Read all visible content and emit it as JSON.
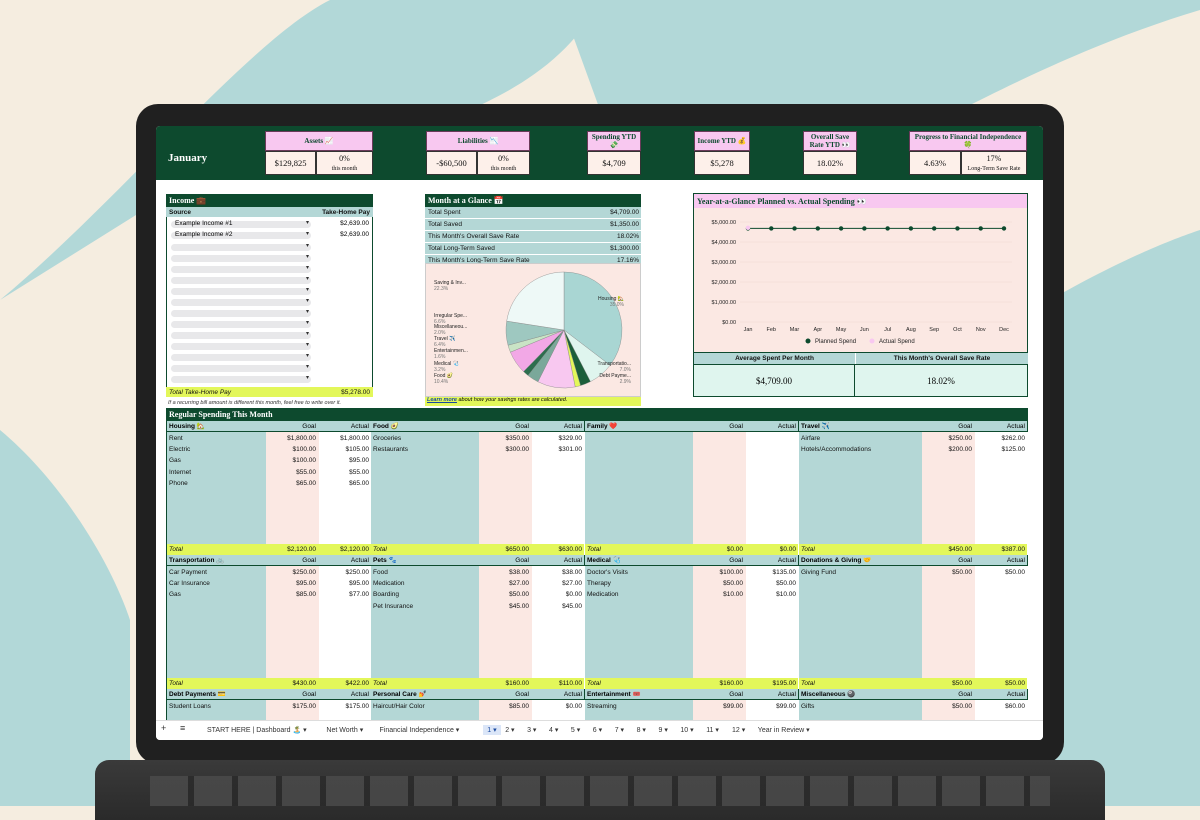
{
  "month": "January",
  "kpis": {
    "assets": {
      "label": "Assets 📈",
      "value": "$129,825",
      "pct": "0%",
      "sub": "this month"
    },
    "liabilities": {
      "label": "Liabilities 📉",
      "value": "-$60,500",
      "pct": "0%",
      "sub": "this month"
    },
    "spending": {
      "label": "Spending YTD💸",
      "value": "$4,709"
    },
    "income": {
      "label": "Income YTD 💰",
      "value": "$5,278"
    },
    "saverate": {
      "label": "Overall Save Rate YTD 👀",
      "value": "18.02%"
    },
    "progress": {
      "label": "Progress to Financial Independence 🍀",
      "value": "4.63%",
      "pct": "17%",
      "sub": "Long-Term Save Rate"
    }
  },
  "income": {
    "title": "Income 💼",
    "col_source": "Source",
    "col_pay": "Take-Home Pay",
    "rows": [
      {
        "name": "Example Income #1",
        "amount": "$2,639.00"
      },
      {
        "name": "Example Income #2",
        "amount": "$2,639.00"
      }
    ],
    "total_label": "Total Take-Home Pay",
    "total": "$5,278.00",
    "note": "If a recurring bill amount is different this month, feel free to write over it."
  },
  "glance": {
    "title": "Month at a Glance 📅",
    "rows": [
      {
        "label": "Total Spent",
        "value": "$4,709.00"
      },
      {
        "label": "Total Saved",
        "value": "$1,350.00"
      },
      {
        "label": "This Month's Overall Save Rate",
        "value": "18.02%"
      },
      {
        "label": "Total Long-Term Saved",
        "value": "$1,300.00"
      },
      {
        "label": "This Month's Long-Term Save Rate",
        "value": "17.16%"
      }
    ],
    "learn_link": "Learn more",
    "learn_text": " about how your savings rates are calculated."
  },
  "pie": {
    "labels": [
      {
        "name": "Saving & Inv...",
        "pct": "22.3%"
      },
      {
        "name": "Housing 🏡",
        "pct": "35.0%"
      },
      {
        "name": "Irregular Spe...",
        "pct": "6.6%"
      },
      {
        "name": "Miscellaneou...",
        "pct": "2.0%"
      },
      {
        "name": "Travel ✈️",
        "pct": "6.4%"
      },
      {
        "name": "Entertainmen...",
        "pct": "1.6%"
      },
      {
        "name": "Medical 🩺",
        "pct": "3.2%"
      },
      {
        "name": "Food 🥑",
        "pct": "10.4%"
      },
      {
        "name": "Transportatio...",
        "pct": "7.0%"
      },
      {
        "name": "Debt Payme...",
        "pct": "2.9%"
      }
    ],
    "slices": [
      {
        "v": 35.0,
        "c": "#a9d6d3"
      },
      {
        "v": 7.0,
        "c": "#dff5ee"
      },
      {
        "v": 2.9,
        "c": "#1b5e3a"
      },
      {
        "v": 1.5,
        "c": "#e3f75a"
      },
      {
        "v": 10.4,
        "c": "#f8c8f0"
      },
      {
        "v": 3.2,
        "c": "#7aa89a"
      },
      {
        "v": 1.6,
        "c": "#2d6e4e"
      },
      {
        "v": 6.4,
        "c": "#f2a8e6"
      },
      {
        "v": 2.0,
        "c": "#c9e4c5"
      },
      {
        "v": 6.6,
        "c": "#9ec8c0"
      },
      {
        "v": 22.3,
        "c": "#eef9f7"
      }
    ]
  },
  "chart_data": {
    "type": "line",
    "title": "Year-at-a-Glance Planned vs. Actual Spending 👀",
    "categories": [
      "Jan",
      "Feb",
      "Mar",
      "Apr",
      "May",
      "Jun",
      "Jul",
      "Aug",
      "Sep",
      "Oct",
      "Nov",
      "Dec"
    ],
    "y_ticks": [
      "$0.00",
      "$1,000.00",
      "$2,000.00",
      "$3,000.00",
      "$4,000.00",
      "$5,000.00"
    ],
    "ylim": [
      0,
      5000
    ],
    "series": [
      {
        "name": "Planned Spend",
        "values": [
          4680,
          4680,
          4680,
          4680,
          4680,
          4680,
          4680,
          4680,
          4680,
          4680,
          4680,
          4680
        ],
        "color": "#0d4a2e"
      },
      {
        "name": "Actual Spend",
        "values": [
          4709
        ],
        "color": "#f8c8f0"
      }
    ]
  },
  "summary": {
    "avg_label": "Average Spent Per Month",
    "avg_value": "$4,709.00",
    "rate_label": "This Month's Overall Save Rate",
    "rate_value": "18.02%"
  },
  "regular": {
    "title": "Regular Spending This Month",
    "goal": "Goal",
    "actual": "Actual",
    "total": "Total",
    "row1": [
      {
        "name": "Housing 🏡",
        "items": [
          [
            "Rent",
            "$1,800.00",
            "$1,800.00"
          ],
          [
            "Electric",
            "$100.00",
            "$105.00"
          ],
          [
            "Gas",
            "$100.00",
            "$95.00"
          ],
          [
            "Internet",
            "$55.00",
            "$55.00"
          ],
          [
            "Phone",
            "$65.00",
            "$65.00"
          ]
        ],
        "total": [
          "$2,120.00",
          "$2,120.00"
        ]
      },
      {
        "name": "Food 🥑",
        "items": [
          [
            "Groceries",
            "$350.00",
            "$329.00"
          ],
          [
            "Restaurants",
            "$300.00",
            "$301.00"
          ]
        ],
        "total": [
          "$650.00",
          "$630.00"
        ]
      },
      {
        "name": "Family ❤️",
        "items": [],
        "total": [
          "$0.00",
          "$0.00"
        ]
      },
      {
        "name": "Travel ✈️",
        "items": [
          [
            "Airfare",
            "$250.00",
            "$262.00"
          ],
          [
            "Hotels/Accommodations",
            "$200.00",
            "$125.00"
          ]
        ],
        "total": [
          "$450.00",
          "$387.00"
        ]
      }
    ],
    "row2": [
      {
        "name": "Transportation 🚲",
        "items": [
          [
            "Car Payment",
            "$250.00",
            "$250.00"
          ],
          [
            "Car Insurance",
            "$95.00",
            "$95.00"
          ],
          [
            "Gas",
            "$85.00",
            "$77.00"
          ]
        ],
        "total": [
          "$430.00",
          "$422.00"
        ]
      },
      {
        "name": "Pets 🐾",
        "items": [
          [
            "Food",
            "$38.00",
            "$38.00"
          ],
          [
            "Medication",
            "$27.00",
            "$27.00"
          ],
          [
            "Boarding",
            "$50.00",
            "$0.00"
          ],
          [
            "Pet Insurance",
            "$45.00",
            "$45.00"
          ]
        ],
        "total": [
          "$160.00",
          "$110.00"
        ]
      },
      {
        "name": "Medical 🩺",
        "items": [
          [
            "Doctor's Visits",
            "$100.00",
            "$135.00"
          ],
          [
            "Therapy",
            "$50.00",
            "$50.00"
          ],
          [
            "Medication",
            "$10.00",
            "$10.00"
          ]
        ],
        "total": [
          "$160.00",
          "$195.00"
        ]
      },
      {
        "name": "Donations & Giving 🤝",
        "items": [
          [
            "Giving Fund",
            "$50.00",
            "$50.00"
          ]
        ],
        "total": [
          "$50.00",
          "$50.00"
        ]
      }
    ],
    "row3": [
      {
        "name": "Debt Payments 💳",
        "items": [
          [
            "Student Loans",
            "$175.00",
            "$175.00"
          ]
        ]
      },
      {
        "name": "Personal Care 💅",
        "items": [
          [
            "Haircut/Hair Color",
            "$85.00",
            "$0.00"
          ]
        ]
      },
      {
        "name": "Entertainment 🎟️",
        "items": [
          [
            "Streaming",
            "$99.00",
            "$99.00"
          ]
        ]
      },
      {
        "name": "Miscellaneous 🎱",
        "items": [
          [
            "Gifts",
            "$50.00",
            "$60.00"
          ]
        ]
      }
    ]
  },
  "tabs": [
    "START HERE | Dashboard 🏝️",
    "Net Worth",
    "Financial Independence",
    "1",
    "2",
    "3",
    "4",
    "5",
    "6",
    "7",
    "8",
    "9",
    "10",
    "11",
    "12",
    "Year in Review"
  ]
}
